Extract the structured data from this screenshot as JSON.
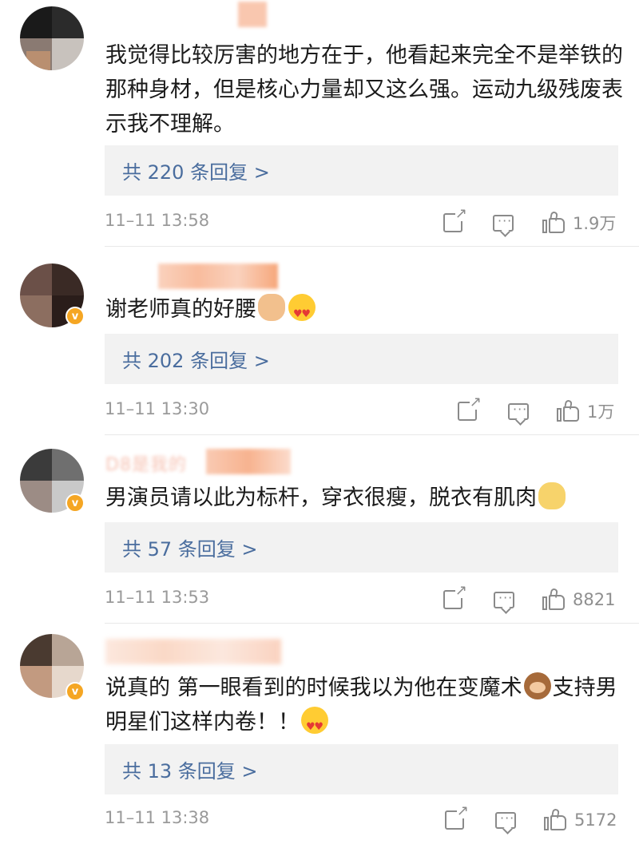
{
  "colors": {
    "reply_link": "#4a6d9e",
    "badge": "#f5a623",
    "meta_text": "#9a9a9a",
    "reply_bg": "#f2f2f2"
  },
  "comments": [
    {
      "username": "",
      "text": "我觉得比较厉害的地方在于，他看起来完全不是举铁的那种身材，但是核心力量却又这么强。运动九级残废表示我不理解。",
      "emoji": [],
      "reply_link": "共 220 条回复 >",
      "time": "11–11 13:58",
      "likes": "1.9万",
      "verified": false
    },
    {
      "username": "",
      "text": "谢老师真的好腰",
      "emoji": [
        "clapping-hands-emoji",
        "heart-eyes-emoji"
      ],
      "reply_link": "共 202 条回复 >",
      "time": "11–11 13:30",
      "likes": "1万",
      "verified": true
    },
    {
      "username": "D8是我的",
      "text": "男演员请以此为标杆，穿衣很瘦，脱衣有肌肉",
      "emoji": [
        "cat-emoji"
      ],
      "reply_link": "共 57 条回复 >",
      "time": "11–11 13:53",
      "likes": "8821",
      "verified": true
    },
    {
      "username": "",
      "text_a": "说真的 第一眼看到的时候我以为他在变魔术",
      "text_b": "支持男明星们这样内卷！！",
      "emoji": [
        "see-no-evil-monkey-emoji",
        "heart-eyes-emoji"
      ],
      "reply_link": "共 13 条回复 >",
      "time": "11–11 13:38",
      "likes": "5172",
      "verified": true
    }
  ]
}
